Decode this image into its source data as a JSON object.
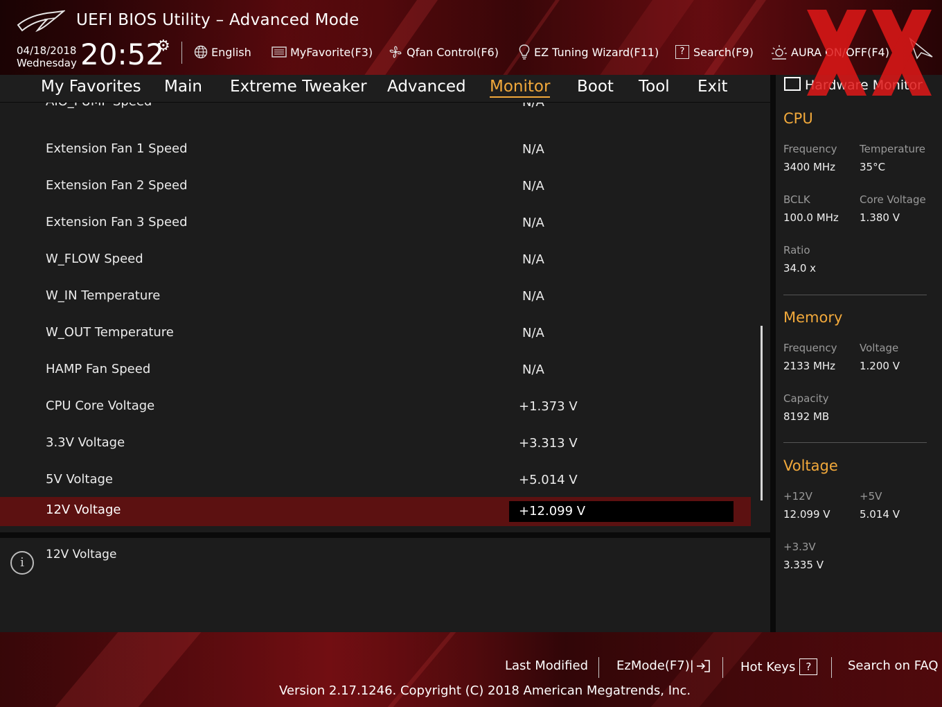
{
  "header": {
    "title": "UEFI BIOS Utility – Advanced Mode",
    "date": "04/18/2018",
    "weekday": "Wednesday",
    "time": "20:52",
    "tools": [
      {
        "icon": "globe-icon",
        "label": "English"
      },
      {
        "icon": "favorites-list-icon",
        "label": "MyFavorite(F3)"
      },
      {
        "icon": "fan-icon",
        "label": "Qfan Control(F6)"
      },
      {
        "icon": "lightbulb-icon",
        "label": "EZ Tuning Wizard(F11)"
      },
      {
        "icon": "question-box-icon",
        "label": "Search(F9)"
      },
      {
        "icon": "aura-light-icon",
        "label": "AURA ON/OFF(F4)"
      }
    ]
  },
  "nav": {
    "tabs": [
      "My Favorites",
      "Main",
      "Extreme Tweaker",
      "Advanced",
      "Monitor",
      "Boot",
      "Tool",
      "Exit"
    ],
    "active": "Monitor"
  },
  "list": {
    "partial_label": "AIO_PUMP Speed",
    "partial_value": "N/A",
    "rows": [
      {
        "label": "Extension Fan 1 Speed",
        "value": "N/A"
      },
      {
        "label": "Extension Fan 2 Speed",
        "value": "N/A"
      },
      {
        "label": "Extension Fan 3 Speed",
        "value": "N/A"
      },
      {
        "label": "W_FLOW Speed",
        "value": "N/A"
      },
      {
        "label": "W_IN Temperature",
        "value": "N/A"
      },
      {
        "label": "W_OUT Temperature",
        "value": "N/A"
      },
      {
        "label": "HAMP Fan Speed",
        "value": "N/A"
      },
      {
        "label": "CPU Core Voltage",
        "value": "+1.373 V"
      },
      {
        "label": "3.3V Voltage",
        "value": "+3.313 V"
      },
      {
        "label": "5V Voltage",
        "value": "+5.014 V"
      },
      {
        "label": "12V Voltage",
        "value": "+12.099 V"
      }
    ],
    "selected_index": 10
  },
  "info": {
    "text": "12V Voltage"
  },
  "hardware_monitor": {
    "title": "Hardware Monitor",
    "cpu": {
      "heading": "CPU",
      "frequency_label": "Frequency",
      "frequency": "3400 MHz",
      "temperature_label": "Temperature",
      "temperature": "35°C",
      "bclk_label": "BCLK",
      "bclk": "100.0 MHz",
      "core_voltage_label": "Core Voltage",
      "core_voltage": "1.380 V",
      "ratio_label": "Ratio",
      "ratio": "34.0 x"
    },
    "memory": {
      "heading": "Memory",
      "frequency_label": "Frequency",
      "frequency": "2133 MHz",
      "voltage_label": "Voltage",
      "voltage": "1.200 V",
      "capacity_label": "Capacity",
      "capacity": "8192 MB"
    },
    "voltage": {
      "heading": "Voltage",
      "v12_label": "+12V",
      "v12": "12.099 V",
      "v5_label": "+5V",
      "v5": "5.014 V",
      "v33_label": "+3.3V",
      "v33": "3.335 V"
    }
  },
  "footer": {
    "last_modified": "Last Modified",
    "ezmode": "EzMode(F7)|",
    "hotkeys": "Hot Keys",
    "hotkeys_box": "?",
    "faq": "Search on FAQ",
    "version": "Version 2.17.1246. Copyright (C) 2018 American Megatrends, Inc."
  },
  "colors": {
    "accent": "#f2a93b",
    "selected_row": "#5c1111",
    "banner_red": "#7a0d12"
  }
}
